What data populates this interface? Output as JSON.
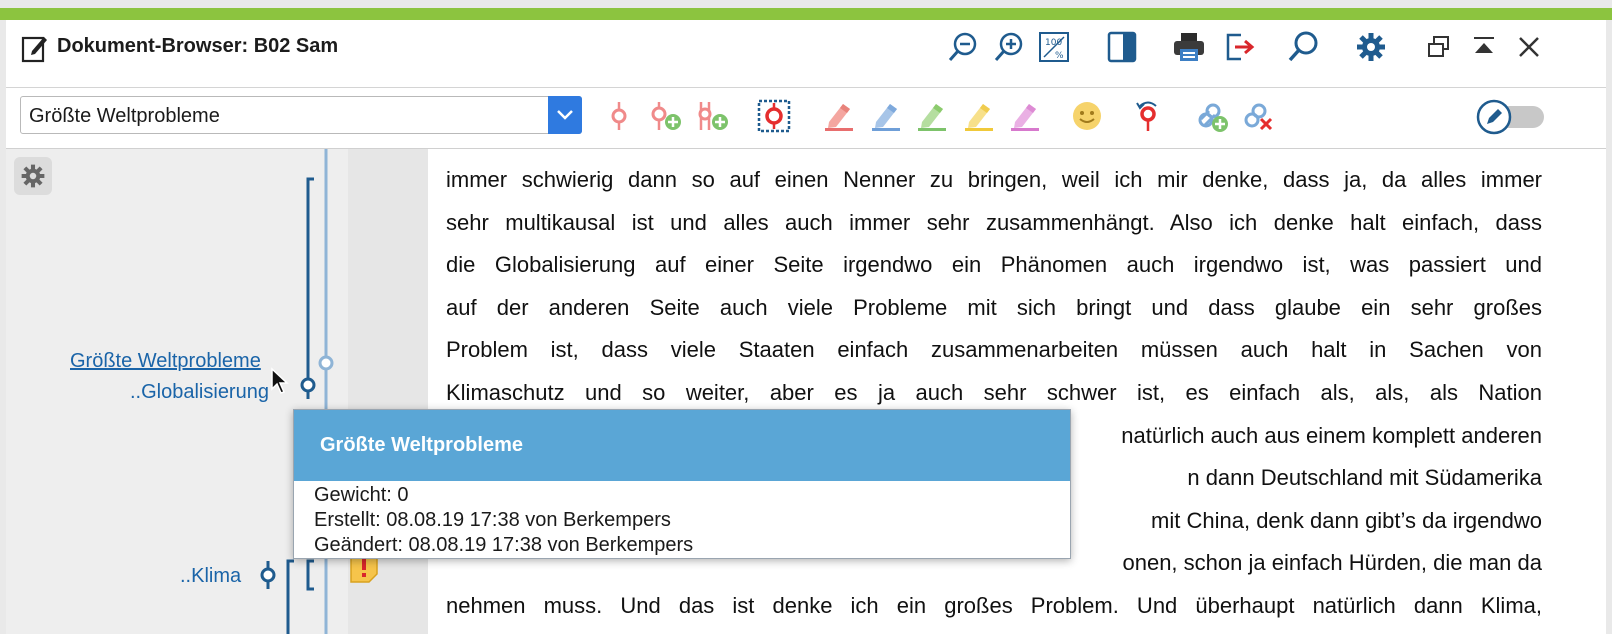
{
  "window": {
    "title": "Dokument-Browser: B02 Sam"
  },
  "titlebar_icons": [
    "zoom-out-icon",
    "zoom-in-icon",
    "zoom-100-icon",
    "split-view-icon",
    "print-icon",
    "export-icon",
    "search-icon",
    "settings-icon",
    "undock-icon",
    "collapse-icon",
    "close-icon"
  ],
  "toolbar": {
    "code_select": {
      "value": "Größte Weltprobleme"
    },
    "tools": [
      "code-icon",
      "new-code-icon",
      "code-in-vivo-icon",
      "code-selection-icon",
      "highlight-red-icon",
      "highlight-blue-icon",
      "highlight-green-icon",
      "highlight-yellow-icon",
      "highlight-pink-icon",
      "emoticode-icon",
      "undo-code-icon",
      "link-add-icon",
      "link-remove-icon"
    ],
    "edit_mode_toggle": "off"
  },
  "colors": {
    "accent_bar": "#8cc43f",
    "icon_blue": "#1f5b8e",
    "code_blue": "#1a64a8",
    "popup_header": "#5aa6d6"
  },
  "left_pane": {
    "codes": [
      {
        "label": "Größte Weltprobleme",
        "underlined": true
      },
      {
        "label": "..Globalisierung"
      },
      {
        "label": "..Klima"
      }
    ]
  },
  "document": {
    "lines": [
      "immer schwierig dann so auf einen Nenner zu bringen, weil ich mir denke, dass ja, da alles immer",
      "sehr multikausal ist und alles auch immer sehr zusammenhängt. Also ich denke halt einfach, dass",
      "die Globalisierung auf einer Seite irgendwo ein Phänomen auch irgendwo ist, was passiert und",
      "auf der anderen Seite auch viele Probleme mit sich bringt und dass glaube ein sehr großes",
      "Problem ist, dass viele Staaten einfach zusammenarbeiten müssen auch halt in Sachen von",
      "Klimaschutz und so weiter, aber es ja auch sehr schwer ist, es einfach als, als, als Nation",
      "natürlich auch aus einem komplett anderen",
      "n dann Deutschland mit Südamerika",
      "mit China, denk dann gibt’s da irgendwo",
      "onen, schon ja einfach Hürden, die man da",
      "nehmen muss. Und das ist denke ich ein großes Problem. Und überhaupt natürlich dann Klima,"
    ]
  },
  "tooltip": {
    "title": "Größte Weltprobleme",
    "weight": "Gewicht: 0",
    "created": "Erstellt: 08.08.19 17:38 von Berkempers",
    "modified": "Geändert: 08.08.19 17:38 von Berkempers"
  }
}
